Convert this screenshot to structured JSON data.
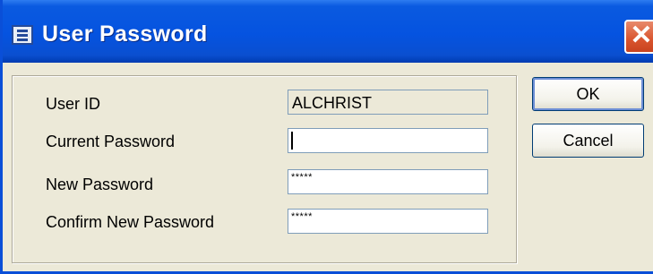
{
  "window": {
    "title": "User Password",
    "icon": "form-icon",
    "close_icon": "close-icon",
    "close_label": "✕"
  },
  "form": {
    "user_id": {
      "label": "User ID",
      "value": "ALCHRIST"
    },
    "current_password": {
      "label": "Current Password",
      "value": ""
    },
    "new_password": {
      "label": "New Password",
      "value": "*****"
    },
    "confirm_password": {
      "label": "Confirm New Password",
      "value": "*****"
    }
  },
  "buttons": {
    "ok": "OK",
    "cancel": "Cancel"
  },
  "colors": {
    "titlebar": "#0553e0",
    "close": "#d9542e",
    "client": "#ece9d8"
  }
}
